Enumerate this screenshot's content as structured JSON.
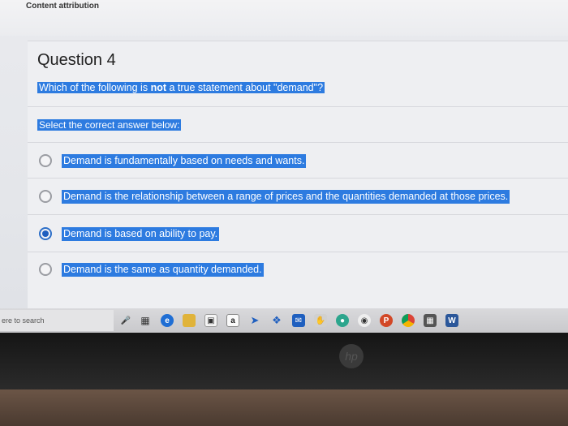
{
  "header": {
    "attribution": "Content attribution"
  },
  "question": {
    "title": "Question 4",
    "prompt_before": "Which of the following is ",
    "prompt_emphasis": "not",
    "prompt_after": " a true statement about \"demand\"?",
    "instruction": "Select the correct answer below:",
    "options": [
      {
        "label": "Demand is fundamentally based on needs and wants.",
        "selected": false
      },
      {
        "label": "Demand is the relationship between a range of prices and the quantities demanded at those prices.",
        "selected": false
      },
      {
        "label": "Demand is based on ability to pay.",
        "selected": true
      },
      {
        "label": "Demand is the same as quantity demanded.",
        "selected": false
      }
    ]
  },
  "taskbar": {
    "search_placeholder": "ere to search",
    "icons": [
      "mic-icon",
      "task-view-icon",
      "edge-icon",
      "file-explorer-icon",
      "store-icon",
      "amazon-icon",
      "arrow-icon",
      "dropbox-icon",
      "mail-icon",
      "hand-icon",
      "chat-icon",
      "camera-icon",
      "powerpoint-icon",
      "chrome-icon",
      "calculator-icon",
      "word-icon"
    ],
    "amazon_glyph": "a"
  },
  "laptop": {
    "logo_text": "hp"
  },
  "colors": {
    "highlight": "#2d7be0",
    "radio_selected": "#1f5fbf"
  }
}
